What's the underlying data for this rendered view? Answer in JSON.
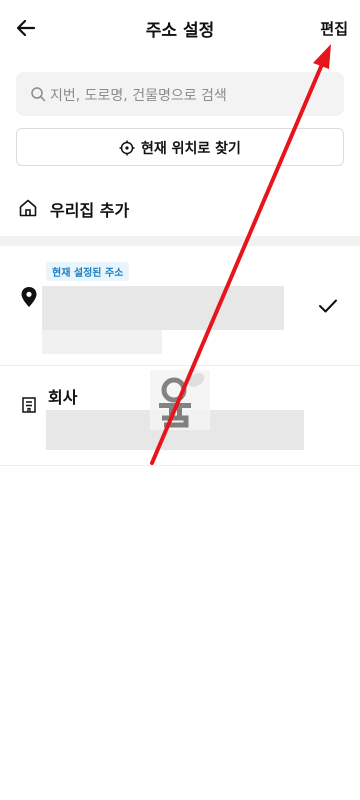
{
  "header": {
    "title": "주소 설정",
    "edit_label": "편집"
  },
  "search": {
    "placeholder": "지번, 도로명, 건물명으로 검색"
  },
  "locate": {
    "label": "현재 위치로 찾기"
  },
  "home": {
    "label": "우리집 추가"
  },
  "addresses": [
    {
      "badge": "현재 설정된 주소",
      "selected": true
    },
    {
      "name": "회사"
    }
  ],
  "colors": {
    "annotation_arrow": "#e8141c",
    "badge_bg": "#e8f5fc",
    "badge_text": "#1d7fbf"
  },
  "icons": [
    "back-arrow-icon",
    "search-icon",
    "crosshair-icon",
    "home-icon",
    "location-pin-icon",
    "checkmark-icon",
    "building-icon"
  ]
}
